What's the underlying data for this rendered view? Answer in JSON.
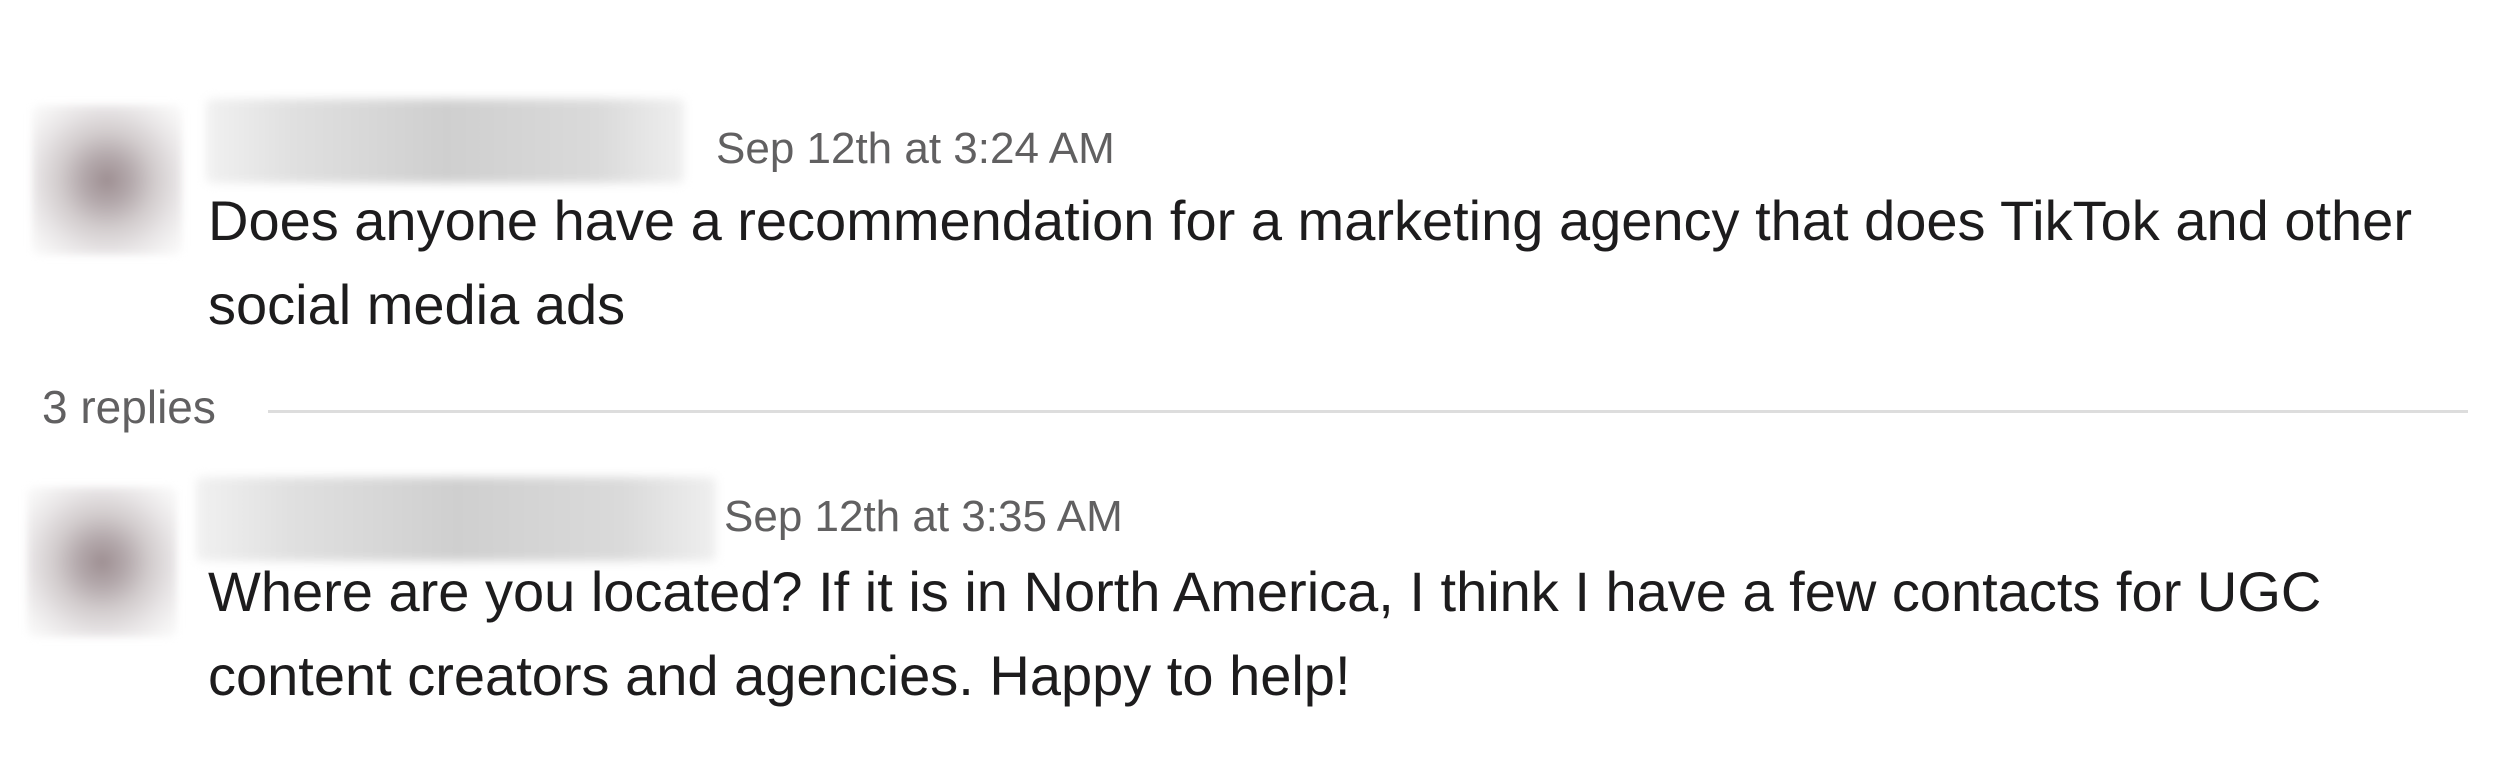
{
  "messages": [
    {
      "sender_name": "",
      "timestamp": "Sep 12th at 3:24 AM",
      "text": "Does anyone have a recommendation for a marketing agency that does TikTok and other social media ads"
    },
    {
      "sender_name": "",
      "timestamp": "Sep 12th at 3:35 AM",
      "text": "Where are you located? If it is in North America, I think I have a few contacts for UGC content creators and agencies. Happy to help!"
    }
  ],
  "thread": {
    "replies_label": "3 replies"
  }
}
